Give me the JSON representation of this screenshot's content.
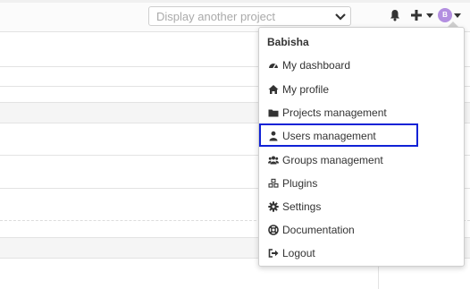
{
  "header": {
    "project_select_placeholder": "Display another project",
    "avatar_initial": "B"
  },
  "user_menu": {
    "username": "Babisha",
    "items": [
      {
        "label": "My dashboard",
        "icon": "dashboard-icon"
      },
      {
        "label": "My profile",
        "icon": "home-icon"
      },
      {
        "label": "Projects management",
        "icon": "folder-icon"
      },
      {
        "label": "Users management",
        "icon": "user-icon"
      },
      {
        "label": "Groups management",
        "icon": "users-icon"
      },
      {
        "label": "Plugins",
        "icon": "cubes-icon"
      },
      {
        "label": "Settings",
        "icon": "gear-icon"
      },
      {
        "label": "Documentation",
        "icon": "life-ring-icon"
      },
      {
        "label": "Logout",
        "icon": "sign-out-icon"
      }
    ],
    "highlighted_item": "Users management"
  },
  "colors": {
    "highlight_border": "#1022d6",
    "avatar_bg": "#b38fe0"
  }
}
